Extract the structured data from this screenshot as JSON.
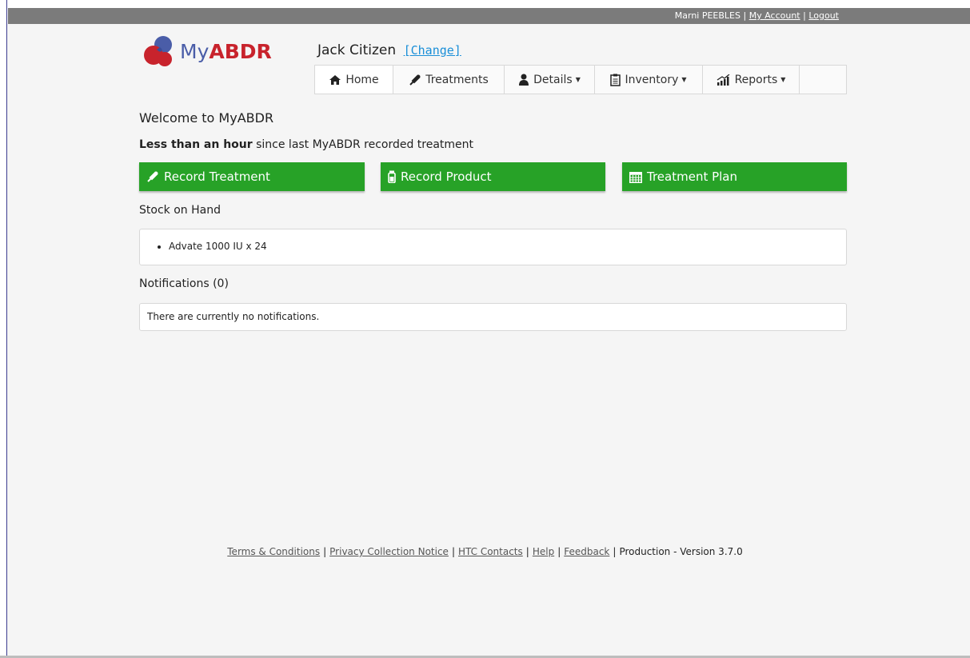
{
  "topbar": {
    "user": "Marni PEEBLES",
    "my_account": "My Account",
    "logout": "Logout"
  },
  "logo": {
    "text_my": "My",
    "text_abdr": "ABDR"
  },
  "patient": {
    "name": "Jack Citizen",
    "change": "[Change]"
  },
  "nav": {
    "home": "Home",
    "treatments": "Treatments",
    "details": "Details",
    "inventory": "Inventory",
    "reports": "Reports"
  },
  "main": {
    "welcome": "Welcome to MyABDR",
    "since_bold": "Less than an hour",
    "since_rest": " since last MyABDR recorded treatment",
    "buttons": {
      "record_treatment": "Record Treatment",
      "record_product": "Record Product",
      "treatment_plan": "Treatment Plan"
    },
    "stock_title": "Stock on Hand",
    "stock_items": [
      "Advate 1000 IU x 24"
    ],
    "notifications_title": "Notifications (0)",
    "notifications_empty": "There are currently no notifications."
  },
  "footer": {
    "terms": "Terms & Conditions",
    "privacy": "Privacy Collection Notice",
    "htc": "HTC Contacts",
    "help": "Help",
    "feedback": "Feedback",
    "version": "Production - Version 3.7.0"
  },
  "colors": {
    "green": "#27a227",
    "brand_blue": "#4a5da8",
    "brand_red": "#c8232c",
    "link": "#1a8fd8"
  }
}
